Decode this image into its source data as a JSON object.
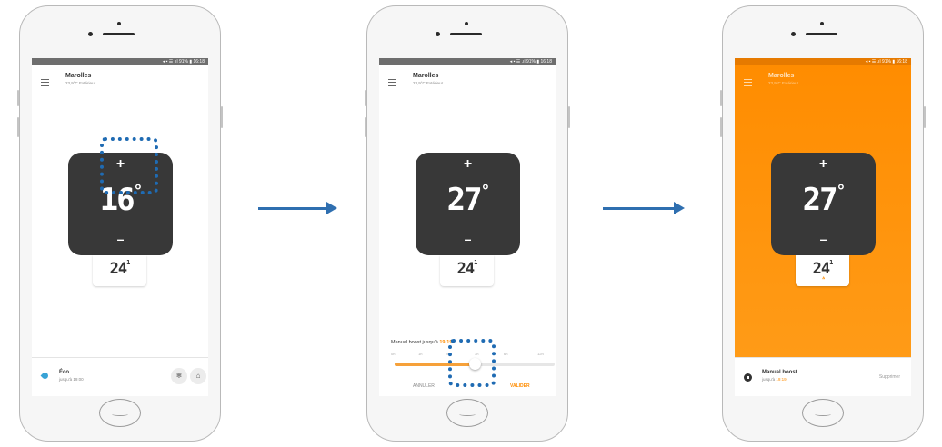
{
  "colors": {
    "accent": "#ff8c00",
    "annotation": "#1f6bb3",
    "valve": "#383838"
  },
  "status_bar": "◂ ▪ ☰ .ıl 91% ▮ 16:18",
  "screen1": {
    "title": "Marolles",
    "subtitle": "23,9°C Extérieur",
    "setpoint": "16",
    "deg": "°",
    "valve_display": "24",
    "valve_super": "1",
    "mode_label": "Éco",
    "mode_until": "jusqu'à 19:00",
    "btn_frost_icon": "❄",
    "btn_away_icon": "⌂"
  },
  "screen2": {
    "title": "Marolles",
    "subtitle": "23,9°C Extérieur",
    "setpoint": "27",
    "deg": "°",
    "valve_display": "24",
    "valve_super": "1",
    "boost_label": "Manual boost jusqu'à ",
    "boost_time": "19:19",
    "slider_ticks": [
      "0h",
      "1h",
      "2h",
      "3h",
      "6h",
      "12h"
    ],
    "slider_value_hours": 3,
    "cancel": "ANNULER",
    "confirm": "VALIDER"
  },
  "screen3": {
    "title": "Marolles",
    "subtitle": "23,9°C Extérieur",
    "setpoint": "27",
    "deg": "°",
    "valve_display": "24",
    "valve_super": "1",
    "boost_indicator": "ᐞ",
    "footer_label": "Manual boost",
    "footer_until": "jusqu'à ",
    "footer_time": "19:19",
    "delete": "Supprimer"
  },
  "icons": [
    "menu-icon",
    "drop-icon",
    "snowflake-icon",
    "home-away-icon",
    "stop-icon",
    "arrow-right-icon"
  ]
}
